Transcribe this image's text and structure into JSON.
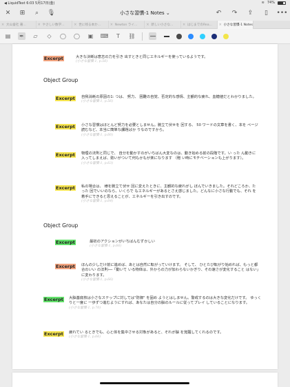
{
  "status": {
    "left": "◀ LiquidText  6:03  5月17日(金)",
    "battery": "74%",
    "battery_level": 0.74
  },
  "nav": {
    "title": "小さな習慣-1 Notes ⌄"
  },
  "tabs": [
    {
      "label": "大山會社 著...",
      "active": false
    },
    {
      "label": "やさしい数学...",
      "active": false
    },
    {
      "label": "世に残る本か...",
      "active": false
    },
    {
      "label": "Newton ライ...",
      "active": false
    },
    {
      "label": "新しい小さな...",
      "active": false
    },
    {
      "label": "はじまでのRea...",
      "active": false
    },
    {
      "label": "小さな習慣-1 Notes",
      "active": true
    }
  ],
  "toolbar": {
    "colors": [
      "#4a4a4a",
      "#2b8cff",
      "#2fd0ff",
      "#1c2e77",
      "#f2e54a"
    ]
  },
  "notes": [
    {
      "tag": "Excerpt",
      "color": "orange",
      "text": "大きな決断は意志の力を引き 出すときと同じエネルギーを使っているようです。",
      "cite": "(小さな習慣-1, p.56)"
    },
    {
      "group": "Object Group"
    },
    {
      "tag": "Excerpt",
      "color": "yellow",
      "text": "自我消耗の原因の1: つは、 努力、 困難の自覚、否定的な感情、主観的な疲れ、血糖値だとわかりました。",
      "cite": "(小さな習慣-1, p.56)"
    },
    {
      "tag": "Excerpt",
      "color": "yellow",
      "text": "小さな習慣はほとんど努力を必要としません。腕立て伏せを 回する、 50 ワードの文章を書く、本を ページ読むなど、本当に簡単な課題ばか りなのですから。",
      "cite": "(小さな習慣-1, p.60)"
    },
    {
      "tag": "Excerpt",
      "color": "yellow",
      "text": "物理の法則と同じで、 自分を動かすのがいちばん大変なのは、動き始める前の段階です。い った ん動きに入ってしまえば、勢いがついて何もかもが楽になります （贈 い時にモチベーションも上がります）。",
      "cite": "(小さな習慣-1, p.63)"
    },
    {
      "tag": "Excerpt",
      "color": "yellow",
      "text": "私の場合は、 様を腕立て伏せ 回に変えたときに、主観的な疲れがし ぼんでいきました。それどころか、たった 回でいいのなら、いくらで もエネルギーがあるとさえ感じました。どんなに小さな行動でも、それ を着手にできると思えることが、エネルギーを引き出すのです。",
      "cite": "(小さな習慣-1, p.64)"
    },
    {
      "group": "Object Group"
    },
    {
      "tag": "Excerpt",
      "color": "green",
      "text": "最初のアクションがいちばんむずかしい",
      "cite": "(小さな習慣-1, p.66)"
    },
    {
      "tag": "Excerpt",
      "color": "orange",
      "text": "ほんの少しだけ前に進めば、あとは自然に転がっていけます。 そして、 ひとたび転がり始めれば、もっと都合のいい の法則──「動いて いる物体は、外からの力が加わらないかぎり、その速さが変化すること はない」に変わります。",
      "cite": "(小さな習慣-1, p.66)"
    },
    {
      "tag": "Excerpt",
      "color": "green",
      "text": "大脳基底核は小さなステップに対しては\"防御\" を固め ようとはしません。警戒するのは大きな変化だけです。 ゆっくりと一度に 一歩ずつ進むようにすれば、あなたは自分の脳のルールに従ってプレイ していることになります。",
      "cite": "(小さな習慣-1, p.70)"
    },
    {
      "tag": "Excerpt",
      "color": "yellow",
      "text": "疲れてい るときでも、心と体を集中させる対象があると、それが脳 を覚醒してくれるのです。",
      "cite": "(小さな習慣-1, p.66)"
    }
  ]
}
